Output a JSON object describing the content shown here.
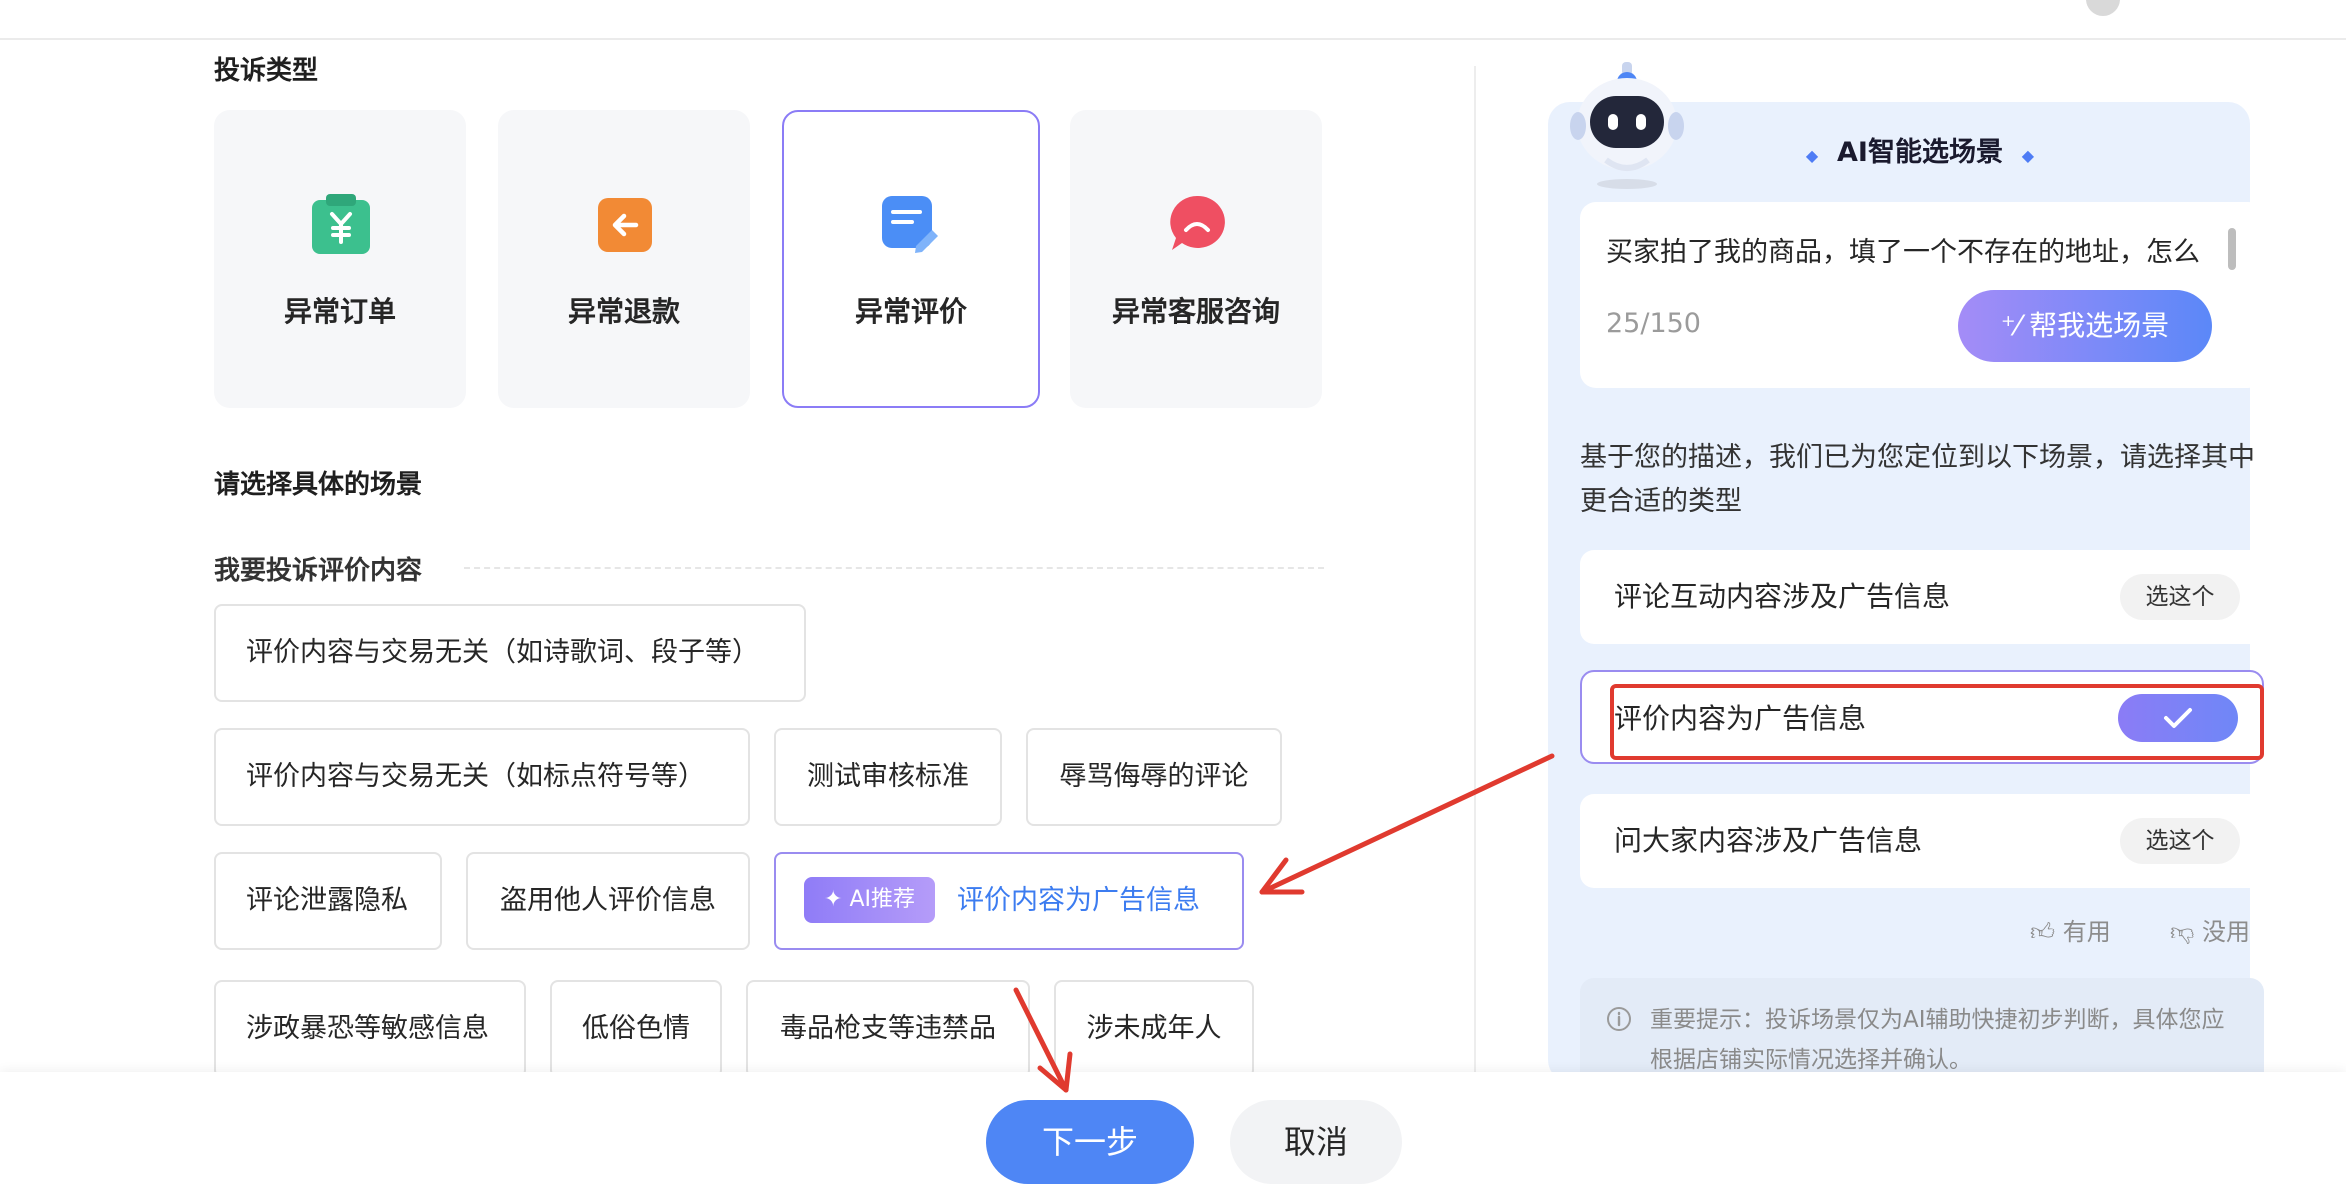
{
  "complaint_type": {
    "heading": "投诉类型",
    "cards": [
      {
        "label": "异常订单",
        "icon": "order-yuan-icon"
      },
      {
        "label": "异常退款",
        "icon": "refund-arrow-icon"
      },
      {
        "label": "异常评价",
        "icon": "review-edit-icon"
      },
      {
        "label": "异常客服咨询",
        "icon": "customer-service-chat-icon"
      }
    ],
    "selected": "异常评价"
  },
  "scene": {
    "heading": "请选择具体的场景",
    "group_title": "我要投诉评价内容",
    "ai_badge": "AI推荐",
    "chips": [
      "评价内容与交易无关（如诗歌词、段子等）",
      "评价内容与交易无关（如标点符号等）",
      "测试审核标准",
      "辱骂侮辱的评论",
      "评论泄露隐私",
      "盗用他人评价信息",
      "评价内容为广告信息",
      "涉政暴恐等敏感信息",
      "低俗色情",
      "毒品枪支等违禁品",
      "涉未成年人"
    ]
  },
  "ai_panel": {
    "title": "AI智能选场景",
    "input_text": "买家拍了我的商品，填了一个不存在的地址，怎么",
    "char_count": "25/150",
    "submit_label": "帮我选场景",
    "result_desc": "基于您的描述，我们已为您定位到以下场景，请选择其中更合适的类型",
    "options": [
      {
        "label": "评论互动内容涉及广告信息",
        "action": "选这个"
      },
      {
        "label": "评价内容为广告信息",
        "action": ""
      },
      {
        "label": "问大家内容涉及广告信息",
        "action": "选这个"
      }
    ],
    "feedback_useful": "有用",
    "feedback_useless": "没用",
    "notice": "重要提示：投诉场景仅为AI辅助快捷初步判断，具体您应根据店铺实际情况选择并确认。"
  },
  "footer": {
    "next_label": "下一步",
    "cancel_label": "取消"
  },
  "colors": {
    "accent_purple": "#8b7cf6",
    "primary_blue": "#4e86f5",
    "highlight_red": "#e03a2f",
    "panel_bg": "#e9f1fd"
  }
}
